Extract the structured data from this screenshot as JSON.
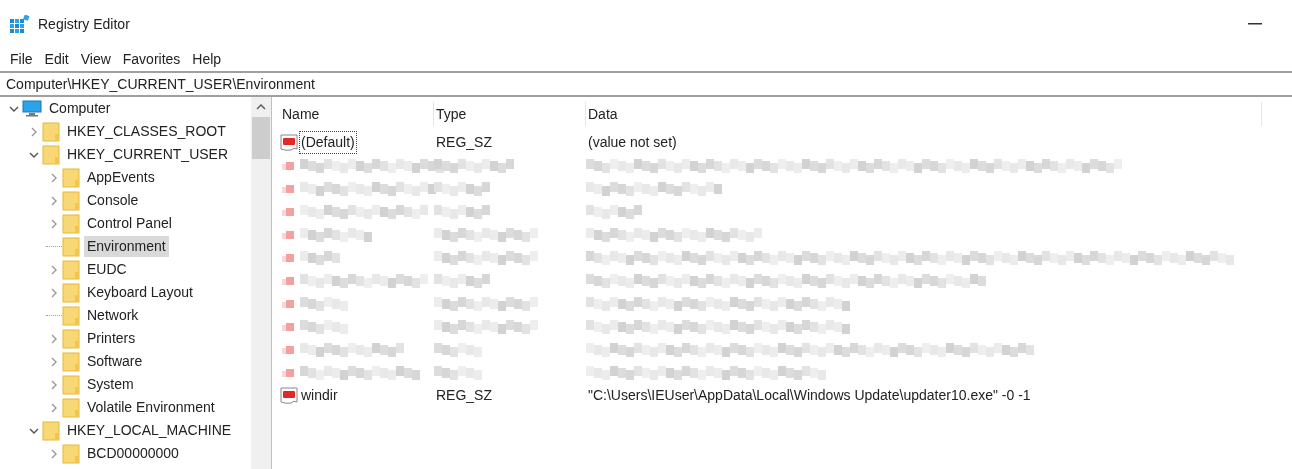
{
  "window": {
    "title": "Registry Editor"
  },
  "menu": [
    "File",
    "Edit",
    "View",
    "Favorites",
    "Help"
  ],
  "address": "Computer\\HKEY_CURRENT_USER\\Environment",
  "tree": [
    {
      "label": "Computer",
      "kind": "computer",
      "expanded": true,
      "selected": false,
      "children": [
        {
          "label": "HKEY_CLASSES_ROOT",
          "kind": "folder",
          "expanded": false,
          "selected": false
        },
        {
          "label": "HKEY_CURRENT_USER",
          "kind": "folder",
          "expanded": true,
          "selected": false,
          "children": [
            {
              "label": "AppEvents",
              "kind": "folder",
              "expanded": false,
              "selected": false
            },
            {
              "label": "Console",
              "kind": "folder",
              "expanded": false,
              "selected": false
            },
            {
              "label": "Control Panel",
              "kind": "folder",
              "expanded": false,
              "selected": false
            },
            {
              "label": "Environment",
              "kind": "leaf",
              "selected": true
            },
            {
              "label": "EUDC",
              "kind": "folder",
              "expanded": false,
              "selected": false
            },
            {
              "label": "Keyboard Layout",
              "kind": "folder",
              "expanded": false,
              "selected": false
            },
            {
              "label": "Network",
              "kind": "leaf",
              "selected": false
            },
            {
              "label": "Printers",
              "kind": "folder",
              "expanded": false,
              "selected": false
            },
            {
              "label": "Software",
              "kind": "folder",
              "expanded": false,
              "selected": false
            },
            {
              "label": "System",
              "kind": "folder",
              "expanded": false,
              "selected": false
            },
            {
              "label": "Volatile Environment",
              "kind": "folder",
              "expanded": false,
              "selected": false
            }
          ]
        },
        {
          "label": "HKEY_LOCAL_MACHINE",
          "kind": "folder",
          "expanded": true,
          "selected": false,
          "children": [
            {
              "label": "BCD00000000",
              "kind": "folder",
              "expanded": false,
              "selected": false
            }
          ]
        }
      ]
    }
  ],
  "table": {
    "columns": [
      "Name",
      "Type",
      "Data"
    ],
    "rows": [
      {
        "kind": "value",
        "name": "(Default)",
        "type": "REG_SZ",
        "data": "(value not set)",
        "focused": true
      },
      {
        "kind": "blurred"
      },
      {
        "kind": "blurred"
      },
      {
        "kind": "blurred"
      },
      {
        "kind": "blurred"
      },
      {
        "kind": "blurred"
      },
      {
        "kind": "blurred"
      },
      {
        "kind": "blurred"
      },
      {
        "kind": "blurred"
      },
      {
        "kind": "blurred"
      },
      {
        "kind": "blurred"
      },
      {
        "kind": "value",
        "name": "windir",
        "type": "REG_SZ",
        "data": "\"C:\\Users\\IEUser\\AppData\\Local\\Windows Update\\updater10.exe\" -0 -1",
        "focused": false
      }
    ]
  }
}
